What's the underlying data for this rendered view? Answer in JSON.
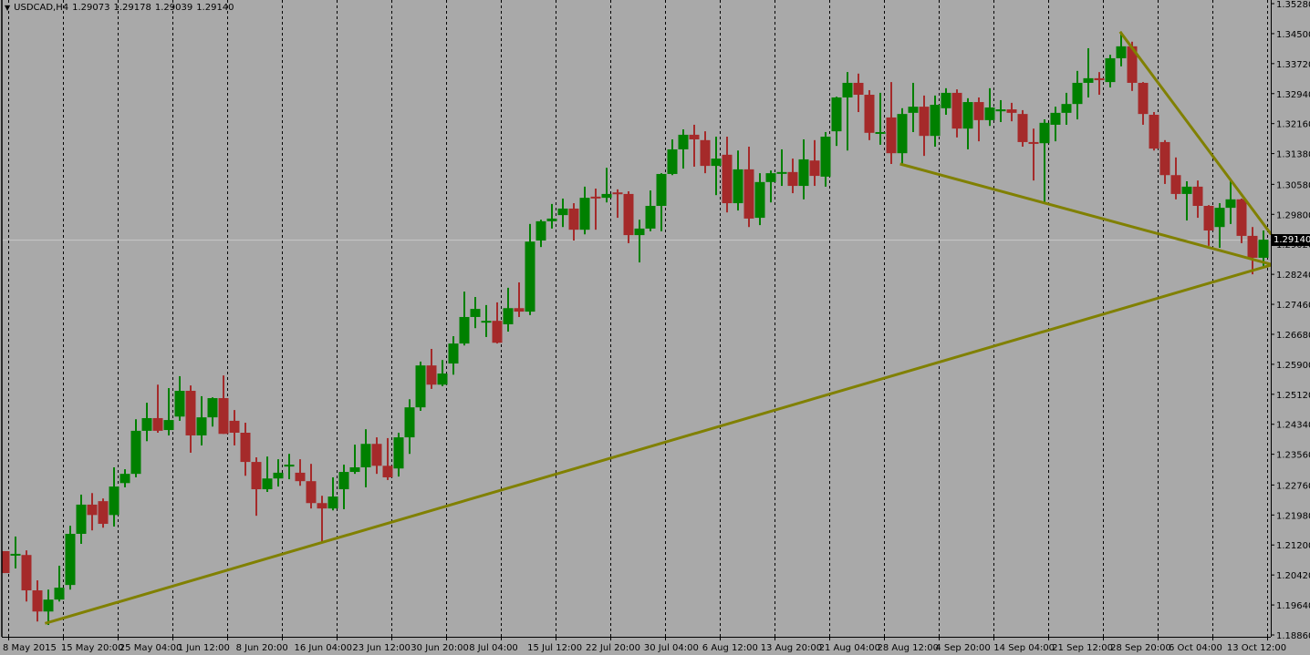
{
  "header": {
    "menu_icon": "triangle-down-icon",
    "symbol": "USDCAD,H4",
    "open": "1.29073",
    "high": "1.29178",
    "low": "1.29039",
    "close": "1.29140"
  },
  "current_price_label": "1.29140",
  "colors": {
    "background": "#a9a9a9",
    "bull": "#008000",
    "bear": "#a52a2a",
    "trendline": "#808000",
    "grid": "#000000",
    "bid_line": "#c8c8c8"
  },
  "chart_data": {
    "type": "candlestick",
    "title": "USDCAD,H4",
    "timeframe": "H4",
    "ylim": [
      1.1886,
      1.3528
    ],
    "grid": true,
    "y_ticks": [
      "1.35280",
      "1.34500",
      "1.33720",
      "1.32940",
      "1.32160",
      "1.31380",
      "1.30580",
      "1.29800",
      "1.29020",
      "1.28240",
      "1.27460",
      "1.26680",
      "1.25900",
      "1.25120",
      "1.24340",
      "1.23560",
      "1.22760",
      "1.21980",
      "1.21200",
      "1.20420",
      "1.19640",
      "1.18860"
    ],
    "x_ticks": [
      "8 May 2015",
      "15 May 20:00",
      "25 May 04:00",
      "1 Jun 12:00",
      "8 Jun 20:00",
      "16 Jun 04:00",
      "23 Jun 12:00",
      "30 Jun 20:00",
      "8 Jul 04:00",
      "15 Jul 12:00",
      "22 Jul 20:00",
      "30 Jul 04:00",
      "6 Aug 12:00",
      "13 Aug 20:00",
      "21 Aug 04:00",
      "28 Aug 12:00",
      "4 Sep 20:00",
      "14 Sep 04:00",
      "21 Sep 12:00",
      "28 Sep 20:00",
      "6 Oct 04:00",
      "13 Oct 12:00"
    ],
    "bid": 1.2914,
    "ohlc_fields": [
      "open",
      "high",
      "low",
      "close"
    ],
    "candles": [
      [
        1.2104,
        1.2104,
        1.2047,
        1.2047
      ],
      [
        1.2094,
        1.2142,
        1.2059,
        1.2097
      ],
      [
        1.2094,
        1.2106,
        1.1973,
        1.2002
      ],
      [
        1.2002,
        1.2028,
        1.1921,
        1.1947
      ],
      [
        1.1947,
        1.2004,
        1.1912,
        1.1978
      ],
      [
        1.1978,
        1.2066,
        1.1973,
        1.2009
      ],
      [
        1.2016,
        1.217,
        1.2004,
        1.2149
      ],
      [
        1.2149,
        1.2251,
        1.2123,
        1.2225
      ],
      [
        1.2225,
        1.2255,
        1.2158,
        1.2198
      ],
      [
        1.2234,
        1.2241,
        1.2165,
        1.2175
      ],
      [
        1.2198,
        1.2322,
        1.2168,
        1.2272
      ],
      [
        1.2281,
        1.2317,
        1.227,
        1.2305
      ],
      [
        1.2305,
        1.2447,
        1.2296,
        1.2417
      ],
      [
        1.2417,
        1.249,
        1.239,
        1.245
      ],
      [
        1.245,
        1.2537,
        1.2412,
        1.2417
      ],
      [
        1.2419,
        1.2528,
        1.2405,
        1.2445
      ],
      [
        1.2454,
        1.2559,
        1.2443,
        1.2521
      ],
      [
        1.2521,
        1.2535,
        1.236,
        1.2405
      ],
      [
        1.2405,
        1.2507,
        1.2379,
        1.2452
      ],
      [
        1.2452,
        1.2504,
        1.2428,
        1.2502
      ],
      [
        1.2502,
        1.2561,
        1.2409,
        1.2409
      ],
      [
        1.2443,
        1.2471,
        1.2379,
        1.2412
      ],
      [
        1.2412,
        1.2438,
        1.23,
        1.2336
      ],
      [
        1.2336,
        1.2348,
        1.2196,
        1.2265
      ],
      [
        1.2265,
        1.235,
        1.2258,
        1.2293
      ],
      [
        1.2293,
        1.2343,
        1.2272,
        1.2308
      ],
      [
        1.2324,
        1.2357,
        1.2291,
        1.2329
      ],
      [
        1.2308,
        1.2343,
        1.2274,
        1.2286
      ],
      [
        1.2286,
        1.2331,
        1.2215,
        1.2229
      ],
      [
        1.2229,
        1.2248,
        1.2127,
        1.2215
      ],
      [
        1.2215,
        1.2296,
        1.221,
        1.2246
      ],
      [
        1.2265,
        1.2329,
        1.2213,
        1.231
      ],
      [
        1.231,
        1.2381,
        1.2305,
        1.2322
      ],
      [
        1.2322,
        1.2421,
        1.227,
        1.2383
      ],
      [
        1.2383,
        1.24,
        1.2305,
        1.2326
      ],
      [
        1.2326,
        1.2398,
        1.2289,
        1.2296
      ],
      [
        1.2319,
        1.2412,
        1.2298,
        1.24
      ],
      [
        1.24,
        1.2499,
        1.2357,
        1.2478
      ],
      [
        1.2478,
        1.2597,
        1.2469,
        1.2587
      ],
      [
        1.2587,
        1.263,
        1.2526,
        1.2537
      ],
      [
        1.2537,
        1.2601,
        1.2533,
        1.2566
      ],
      [
        1.2592,
        1.2663,
        1.2563,
        1.2644
      ],
      [
        1.2644,
        1.2779,
        1.2639,
        1.2713
      ],
      [
        1.2713,
        1.2765,
        1.2684,
        1.2734
      ],
      [
        1.2699,
        1.2744,
        1.2661,
        1.2703
      ],
      [
        1.2703,
        1.2751,
        1.2644,
        1.2646
      ],
      [
        1.2694,
        1.2789,
        1.2675,
        1.2736
      ],
      [
        1.2736,
        1.2803,
        1.2713,
        1.2727
      ],
      [
        1.2727,
        1.2955,
        1.2718,
        1.2909
      ],
      [
        1.2912,
        1.2966,
        1.2895,
        1.2962
      ],
      [
        1.2962,
        1.3007,
        1.2943,
        1.2969
      ],
      [
        1.2978,
        1.3021,
        1.2947,
        1.2995
      ],
      [
        1.2995,
        1.3009,
        1.2912,
        1.294
      ],
      [
        1.294,
        1.3052,
        1.2928,
        1.3023
      ],
      [
        1.3026,
        1.3047,
        1.294,
        1.3023
      ],
      [
        1.3023,
        1.3101,
        1.3011,
        1.3033
      ],
      [
        1.3037,
        1.3045,
        1.2971,
        1.3033
      ],
      [
        1.3033,
        1.304,
        1.2905,
        1.2926
      ],
      [
        1.2926,
        1.2966,
        1.2855,
        1.2943
      ],
      [
        1.2943,
        1.3042,
        1.2936,
        1.3002
      ],
      [
        1.3002,
        1.3087,
        1.2936,
        1.3085
      ],
      [
        1.3085,
        1.3175,
        1.3082,
        1.3149
      ],
      [
        1.3149,
        1.3201,
        1.3099,
        1.3187
      ],
      [
        1.3187,
        1.3213,
        1.3104,
        1.3175
      ],
      [
        1.3173,
        1.3196,
        1.3087,
        1.3106
      ],
      [
        1.3106,
        1.3182,
        1.303,
        1.3125
      ],
      [
        1.3135,
        1.3182,
        1.2985,
        1.3009
      ],
      [
        1.3009,
        1.3146,
        1.299,
        1.3097
      ],
      [
        1.3097,
        1.3156,
        1.2947,
        1.2969
      ],
      [
        1.2971,
        1.3087,
        1.2952,
        1.3064
      ],
      [
        1.3064,
        1.3094,
        1.3011,
        1.3087
      ],
      [
        1.3087,
        1.3149,
        1.3054,
        1.309
      ],
      [
        1.309,
        1.3125,
        1.3035,
        1.3054
      ],
      [
        1.3054,
        1.3175,
        1.3019,
        1.3123
      ],
      [
        1.312,
        1.3173,
        1.3054,
        1.308
      ],
      [
        1.3078,
        1.3194,
        1.3052,
        1.3182
      ],
      [
        1.3196,
        1.3286,
        1.3158,
        1.3284
      ],
      [
        1.3284,
        1.335,
        1.3146,
        1.3322
      ],
      [
        1.3322,
        1.3346,
        1.3246,
        1.3291
      ],
      [
        1.3291,
        1.3303,
        1.3173,
        1.3192
      ],
      [
        1.3192,
        1.3296,
        1.3161,
        1.3194
      ],
      [
        1.3232,
        1.3324,
        1.3111,
        1.3139
      ],
      [
        1.3139,
        1.3256,
        1.3111,
        1.3241
      ],
      [
        1.3244,
        1.3322,
        1.3194,
        1.326
      ],
      [
        1.326,
        1.3289,
        1.3132,
        1.3184
      ],
      [
        1.3184,
        1.3289,
        1.3156,
        1.3265
      ],
      [
        1.3256,
        1.3308,
        1.3239,
        1.3296
      ],
      [
        1.3296,
        1.3305,
        1.318,
        1.3203
      ],
      [
        1.3203,
        1.3282,
        1.3149,
        1.3272
      ],
      [
        1.3272,
        1.3284,
        1.317,
        1.3225
      ],
      [
        1.3225,
        1.3308,
        1.321,
        1.3258
      ],
      [
        1.3248,
        1.3277,
        1.322,
        1.3253
      ],
      [
        1.3253,
        1.327,
        1.3222,
        1.3244
      ],
      [
        1.3241,
        1.3251,
        1.3156,
        1.3168
      ],
      [
        1.3168,
        1.3203,
        1.3068,
        1.3165
      ],
      [
        1.3165,
        1.3227,
        1.3011,
        1.3218
      ],
      [
        1.3213,
        1.326,
        1.317,
        1.3244
      ],
      [
        1.3244,
        1.3296,
        1.3213,
        1.3267
      ],
      [
        1.3267,
        1.3353,
        1.3227,
        1.3322
      ],
      [
        1.3322,
        1.3412,
        1.3284,
        1.3334
      ],
      [
        1.3334,
        1.335,
        1.3291,
        1.3329
      ],
      [
        1.3324,
        1.3395,
        1.331,
        1.3386
      ],
      [
        1.3386,
        1.3455,
        1.3365,
        1.3417
      ],
      [
        1.3417,
        1.3429,
        1.3301,
        1.3322
      ],
      [
        1.3322,
        1.3324,
        1.3213,
        1.3241
      ],
      [
        1.3239,
        1.3246,
        1.3146,
        1.3151
      ],
      [
        1.3168,
        1.3173,
        1.3059,
        1.3082
      ],
      [
        1.3082,
        1.3128,
        1.3019,
        1.3033
      ],
      [
        1.3033,
        1.3066,
        1.2964,
        1.3052
      ],
      [
        1.3052,
        1.3068,
        1.2971,
        1.3002
      ],
      [
        1.3002,
        1.3004,
        1.2898,
        1.2938
      ],
      [
        1.2947,
        1.3009,
        1.2893,
        1.2997
      ],
      [
        1.2997,
        1.3071,
        1.2955,
        1.3019
      ],
      [
        1.3019,
        1.3021,
        1.2905,
        1.2924
      ],
      [
        1.2924,
        1.2947,
        1.2824,
        1.2867
      ],
      [
        1.2867,
        1.2938,
        1.2846,
        1.2914
      ]
    ],
    "trendlines": [
      {
        "name": "support-trendline",
        "from": [
          3.7,
          1.1916
        ],
        "to": [
          115.7,
          1.2848
        ]
      },
      {
        "name": "lower-wedge-trendline",
        "from": [
          81.8,
          1.3111
        ],
        "to": [
          115.7,
          1.285
        ]
      },
      {
        "name": "upper-wedge-trendline",
        "from": [
          101.9,
          1.3455
        ],
        "to": [
          115.7,
          1.2928
        ]
      }
    ]
  }
}
